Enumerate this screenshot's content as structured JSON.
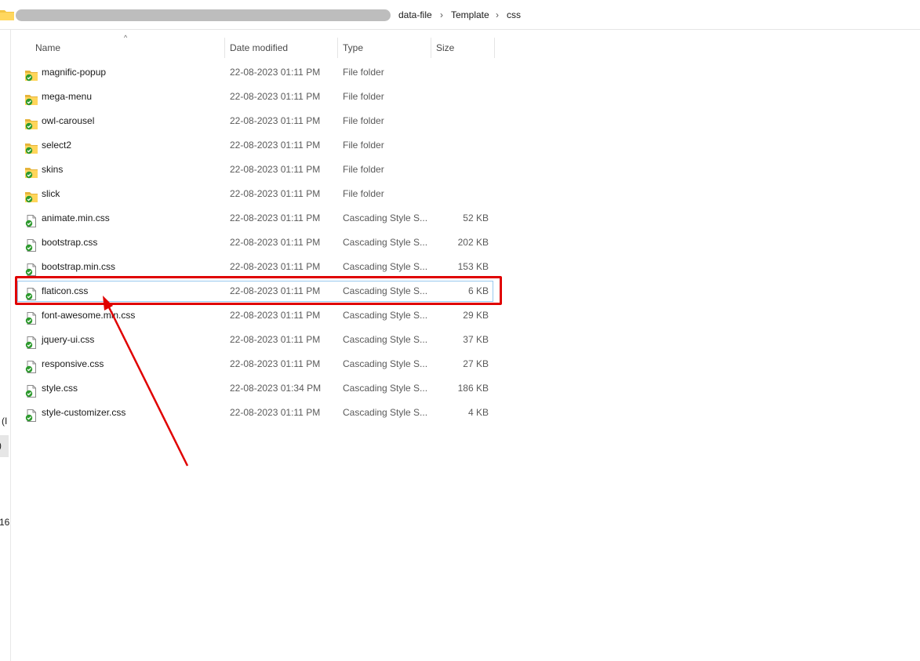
{
  "addressbar": {
    "folder_icon": "folder-icon",
    "crumbs": [
      "data-file",
      "Template",
      "css"
    ],
    "separator": "›"
  },
  "left_pane": {
    "fragments": [
      "l (I",
      ")",
      "16"
    ]
  },
  "columns": {
    "name": "Name",
    "date": "Date modified",
    "type": "Type",
    "size": "Size",
    "sort_indicator": "^"
  },
  "files": [
    {
      "name": "magnific-popup",
      "date": "22-08-2023 01:11 PM",
      "type": "File folder",
      "size": "",
      "icon": "folder-synced-icon"
    },
    {
      "name": "mega-menu",
      "date": "22-08-2023 01:11 PM",
      "type": "File folder",
      "size": "",
      "icon": "folder-synced-icon"
    },
    {
      "name": "owl-carousel",
      "date": "22-08-2023 01:11 PM",
      "type": "File folder",
      "size": "",
      "icon": "folder-synced-icon"
    },
    {
      "name": "select2",
      "date": "22-08-2023 01:11 PM",
      "type": "File folder",
      "size": "",
      "icon": "folder-synced-icon"
    },
    {
      "name": "skins",
      "date": "22-08-2023 01:11 PM",
      "type": "File folder",
      "size": "",
      "icon": "folder-synced-icon"
    },
    {
      "name": "slick",
      "date": "22-08-2023 01:11 PM",
      "type": "File folder",
      "size": "",
      "icon": "folder-synced-icon"
    },
    {
      "name": "animate.min.css",
      "date": "22-08-2023 01:11 PM",
      "type": "Cascading Style S...",
      "size": "52 KB",
      "icon": "css-file-synced-icon"
    },
    {
      "name": "bootstrap.css",
      "date": "22-08-2023 01:11 PM",
      "type": "Cascading Style S...",
      "size": "202 KB",
      "icon": "css-file-synced-icon"
    },
    {
      "name": "bootstrap.min.css",
      "date": "22-08-2023 01:11 PM",
      "type": "Cascading Style S...",
      "size": "153 KB",
      "icon": "css-file-synced-icon"
    },
    {
      "name": "flaticon.css",
      "date": "22-08-2023 01:11 PM",
      "type": "Cascading Style S...",
      "size": "6 KB",
      "icon": "css-file-synced-icon",
      "selected": true
    },
    {
      "name": "font-awesome.min.css",
      "date": "22-08-2023 01:11 PM",
      "type": "Cascading Style S...",
      "size": "29 KB",
      "icon": "css-file-synced-icon"
    },
    {
      "name": "jquery-ui.css",
      "date": "22-08-2023 01:11 PM",
      "type": "Cascading Style S...",
      "size": "37 KB",
      "icon": "css-file-synced-icon"
    },
    {
      "name": "responsive.css",
      "date": "22-08-2023 01:11 PM",
      "type": "Cascading Style S...",
      "size": "27 KB",
      "icon": "css-file-synced-icon"
    },
    {
      "name": "style.css",
      "date": "22-08-2023 01:34 PM",
      "type": "Cascading Style S...",
      "size": "186 KB",
      "icon": "css-file-synced-icon"
    },
    {
      "name": "style-customizer.css",
      "date": "22-08-2023 01:11 PM",
      "type": "Cascading Style S...",
      "size": "4 KB",
      "icon": "css-file-synced-icon"
    }
  ],
  "annotation": {
    "color": "#e00000",
    "target": "flaticon.css"
  }
}
